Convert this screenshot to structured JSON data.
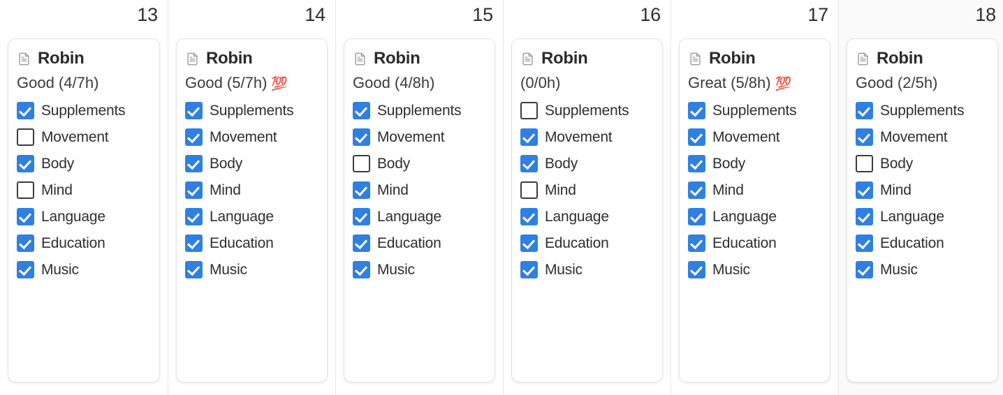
{
  "view": {
    "type": "week-grid",
    "accent_color": "#2f80e0",
    "checkbox_border_color": "#3c3c3c",
    "today_column_background": "#fafafa",
    "column_divider_color": "#e8e8e8"
  },
  "habit_names": [
    "Supplements",
    "Movement",
    "Body",
    "Mind",
    "Language",
    "Education",
    "Music"
  ],
  "days": [
    {
      "day_number": "13",
      "is_today": false,
      "card": {
        "icon": "document-icon",
        "title": "Robin",
        "status": "Good (4/7h)",
        "emoji": "",
        "habits": [
          {
            "label": "Supplements",
            "checked": true
          },
          {
            "label": "Movement",
            "checked": false
          },
          {
            "label": "Body",
            "checked": true
          },
          {
            "label": "Mind",
            "checked": false
          },
          {
            "label": "Language",
            "checked": true
          },
          {
            "label": "Education",
            "checked": true
          },
          {
            "label": "Music",
            "checked": true
          }
        ]
      }
    },
    {
      "day_number": "14",
      "is_today": false,
      "card": {
        "icon": "document-icon",
        "title": "Robin",
        "status": "Good (5/7h)",
        "emoji": "💯",
        "habits": [
          {
            "label": "Supplements",
            "checked": true
          },
          {
            "label": "Movement",
            "checked": true
          },
          {
            "label": "Body",
            "checked": true
          },
          {
            "label": "Mind",
            "checked": true
          },
          {
            "label": "Language",
            "checked": true
          },
          {
            "label": "Education",
            "checked": true
          },
          {
            "label": "Music",
            "checked": true
          }
        ]
      }
    },
    {
      "day_number": "15",
      "is_today": false,
      "card": {
        "icon": "document-icon",
        "title": "Robin",
        "status": "Good (4/8h)",
        "emoji": "",
        "habits": [
          {
            "label": "Supplements",
            "checked": true
          },
          {
            "label": "Movement",
            "checked": true
          },
          {
            "label": "Body",
            "checked": false
          },
          {
            "label": "Mind",
            "checked": true
          },
          {
            "label": "Language",
            "checked": true
          },
          {
            "label": "Education",
            "checked": true
          },
          {
            "label": "Music",
            "checked": true
          }
        ]
      }
    },
    {
      "day_number": "16",
      "is_today": false,
      "card": {
        "icon": "document-icon",
        "title": "Robin",
        "status": "(0/0h)",
        "emoji": "",
        "habits": [
          {
            "label": "Supplements",
            "checked": false
          },
          {
            "label": "Movement",
            "checked": true
          },
          {
            "label": "Body",
            "checked": true
          },
          {
            "label": "Mind",
            "checked": false
          },
          {
            "label": "Language",
            "checked": true
          },
          {
            "label": "Education",
            "checked": true
          },
          {
            "label": "Music",
            "checked": true
          }
        ]
      }
    },
    {
      "day_number": "17",
      "is_today": false,
      "card": {
        "icon": "document-icon",
        "title": "Robin",
        "status": "Great (5/8h)",
        "emoji": "💯",
        "habits": [
          {
            "label": "Supplements",
            "checked": true
          },
          {
            "label": "Movement",
            "checked": true
          },
          {
            "label": "Body",
            "checked": true
          },
          {
            "label": "Mind",
            "checked": true
          },
          {
            "label": "Language",
            "checked": true
          },
          {
            "label": "Education",
            "checked": true
          },
          {
            "label": "Music",
            "checked": true
          }
        ]
      }
    },
    {
      "day_number": "18",
      "is_today": true,
      "card": {
        "icon": "document-icon",
        "title": "Robin",
        "status": "Good (2/5h)",
        "emoji": "",
        "habits": [
          {
            "label": "Supplements",
            "checked": true
          },
          {
            "label": "Movement",
            "checked": true
          },
          {
            "label": "Body",
            "checked": false
          },
          {
            "label": "Mind",
            "checked": true
          },
          {
            "label": "Language",
            "checked": true
          },
          {
            "label": "Education",
            "checked": true
          },
          {
            "label": "Music",
            "checked": true
          }
        ]
      }
    }
  ]
}
